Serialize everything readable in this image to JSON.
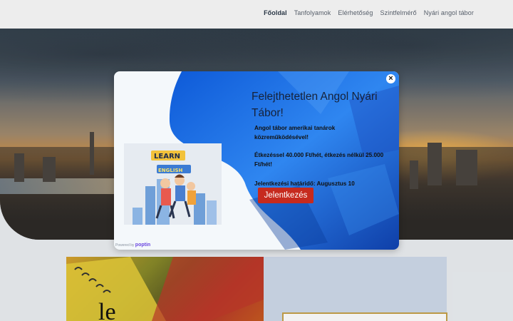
{
  "nav": {
    "items": [
      {
        "label": "Főoldal",
        "active": true
      },
      {
        "label": "Tanfolyamok",
        "active": false
      },
      {
        "label": "Elérhetőség",
        "active": false
      },
      {
        "label": "Szintfelmérő",
        "active": false
      },
      {
        "label": "Nyári angol tábor",
        "active": false
      }
    ]
  },
  "popup": {
    "close_icon": "×",
    "title": "Felejthetetlen Angol Nyári Tábor!",
    "line1": "Angol tábor amerikai tanárok közreműködésével!",
    "line2": "Étkezéssel 40.000 Ft/hét, étkezés nélkül 25.000 Ft/hét!",
    "line3": "Jelentkezési határidő: Augusztus 10",
    "cta_label": "Jelentkezés",
    "image": {
      "word_top": "LEARN",
      "word_bottom": "ENGLISH"
    },
    "powered_prefix": "Powered by",
    "powered_brand": "poptin"
  },
  "colors": {
    "accent": "#c62a1e",
    "popup_blue": "#1a5fe0",
    "title": "#16223a"
  }
}
